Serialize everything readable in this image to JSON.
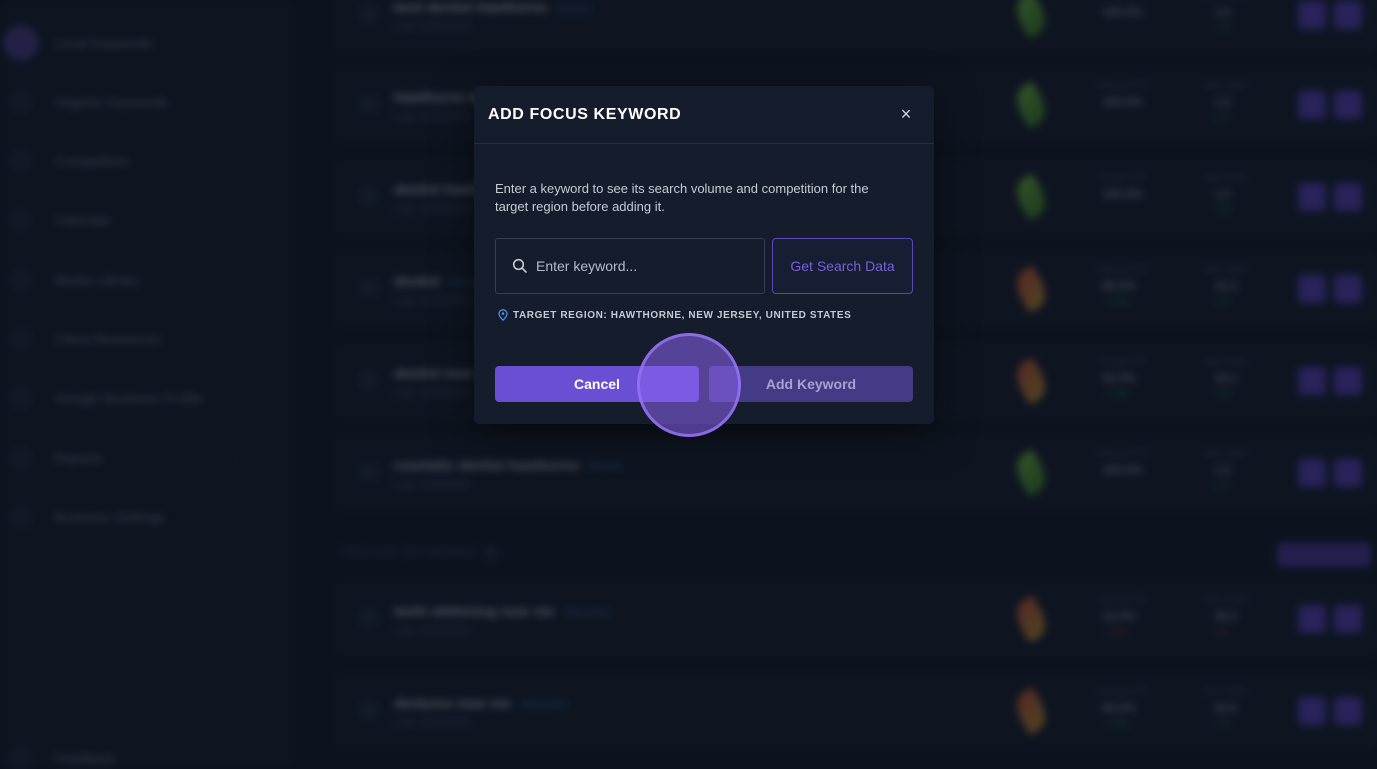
{
  "sidebar": {
    "items": [
      {
        "label": "Local Keywords",
        "active": true,
        "chevron": ""
      },
      {
        "label": "Organic Keywords",
        "active": false,
        "chevron": ""
      },
      {
        "label": "Competitors",
        "active": false,
        "chevron": ""
      },
      {
        "label": "Calendar",
        "active": false,
        "chevron": ""
      },
      {
        "label": "Media Library",
        "active": false,
        "chevron": ""
      },
      {
        "label": "Client Resources",
        "active": false,
        "chevron": ""
      },
      {
        "label": "Google Business Profile",
        "active": false,
        "chevron": "⌄"
      },
      {
        "label": "Reports",
        "active": false,
        "chevron": "⌄"
      },
      {
        "label": "Business Settings",
        "active": false,
        "chevron": ""
      },
      {
        "label": "Feedback",
        "active": false,
        "chevron": ""
      }
    ]
  },
  "keywords": {
    "focus_rows": [
      {
        "title": "best dentist hawthorne",
        "tag": "FOCUS",
        "sub": "Last: 3/22/2026",
        "ctr_label": "Average CTR",
        "ctr": "100.0%",
        "ctr_delta": "",
        "pos_label": "AVG. RANK",
        "pos": "1.0",
        "pos_delta": "+ 0.0",
        "leaf": "green"
      },
      {
        "title": "hawthorne dentist",
        "tag": "",
        "sub": "Last: 3/22/2026",
        "ctr_label": "Average CTR",
        "ctr": "100.0%",
        "ctr_delta": "",
        "pos_label": "AVG. RANK",
        "pos": "1.0",
        "pos_delta": "+ 0.0",
        "leaf": "green"
      },
      {
        "title": "dentist hawthorne",
        "tag": "",
        "sub": "Last: 3/22/2026",
        "ctr_label": "Average CTR",
        "ctr": "100.0%",
        "ctr_delta": "",
        "pos_label": "AVG. RANK",
        "pos": "1.0",
        "pos_delta": "+ 0.0",
        "leaf": "green"
      },
      {
        "title": "dentist",
        "tag": "LOCAL",
        "sub": "Last: 3/22/2026",
        "ctr_label": "Average CTR",
        "ctr": "85.0%",
        "ctr_delta": "+ 0.0%",
        "pos_label": "AVG. RANK",
        "pos": "10.2",
        "pos_delta": "+ 0.0",
        "leaf": "red"
      },
      {
        "title": "dentist near me",
        "tag": "",
        "sub": "Last: 3/22/2026",
        "ctr_label": "Average CTR",
        "ctr": "62.0%",
        "ctr_delta": "+ 0.0%",
        "pos_label": "AVG. RANK",
        "pos": "18.1",
        "pos_delta": "+ 0.0",
        "leaf": "red"
      },
      {
        "title": "cosmetic dentist hawthorne",
        "tag": "FOCUS",
        "sub": "Last: 3/22/2026",
        "ctr_label": "Average CTR",
        "ctr": "100.0%",
        "ctr_delta": "",
        "pos_label": "AVG. RANK",
        "pos": "1.0",
        "pos_delta": "+ 0.0",
        "leaf": "green"
      }
    ],
    "tracked_header": "TRACKED KEYWORDS",
    "tracked_rows": [
      {
        "title": "teeth whitening near me",
        "tag": "TRACKED",
        "sub": "Last: 3/22/2026",
        "ctr_label": "Average CTR",
        "ctr": "12.0%",
        "ctr_delta": "- 0.0%",
        "pos_label": "AVG. RANK",
        "pos": "30.2",
        "pos_delta": "- 0.0",
        "leaf": "red"
      },
      {
        "title": "dentures near me",
        "tag": "TRACKED",
        "sub": "Last: 3/22/2026",
        "ctr_label": "Average CTR",
        "ctr": "60.0%",
        "ctr_delta": "+ 0.0%",
        "pos_label": "AVG. RANK",
        "pos": "20.0",
        "pos_delta": "+ 0.0",
        "leaf": "red"
      }
    ]
  },
  "modal": {
    "title": "ADD FOCUS KEYWORD",
    "close_icon": "×",
    "description": "Enter a keyword to see its search volume and competition for the target region before adding it.",
    "input_value": "",
    "input_placeholder": "Enter keyword...",
    "get_data_label": "Get Search Data",
    "region_label": "TARGET REGION: HAWTHORNE, NEW JERSEY, UNITED STATES",
    "cancel_label": "Cancel",
    "add_label": "Add Keyword"
  },
  "colors": {
    "accent": "#6a4fd4",
    "accent_muted": "#433b86",
    "modal_bg": "#151c2b",
    "page_bg": "#0f1522",
    "pin": "#4f8fe6"
  }
}
